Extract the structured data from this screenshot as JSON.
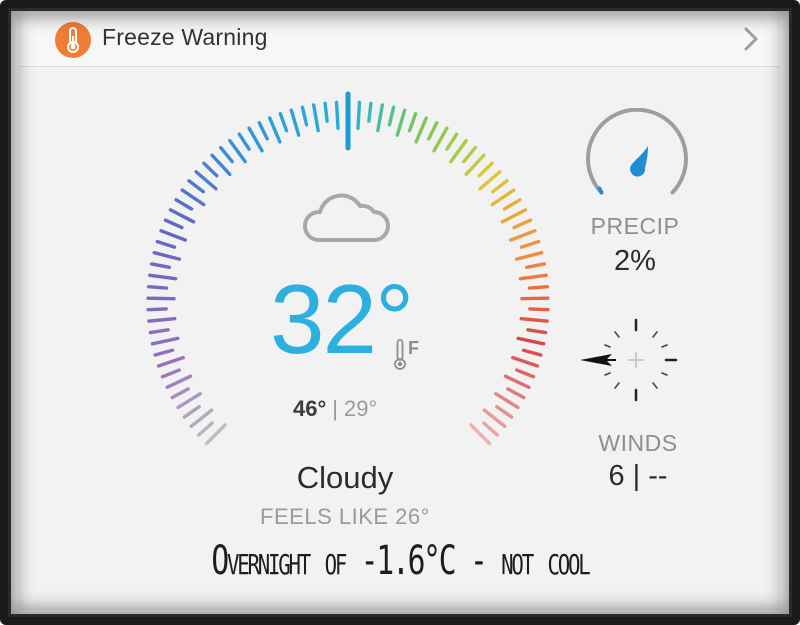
{
  "alert": {
    "title": "Freeze Warning",
    "icon": "thermometer-icon",
    "icon_color": "#f07d35"
  },
  "weather": {
    "temperature": "32°",
    "unit": "F",
    "high": "46°",
    "separator": "|",
    "low": "29°",
    "condition": "Cloudy",
    "condition_icon": "cloud-icon",
    "feels_like": "FEELS LIKE 26°",
    "accent_color": "#2bb0df"
  },
  "precip": {
    "label": "PRECIP",
    "value": "2%",
    "icon": "raindrop-icon",
    "level": 0.02
  },
  "winds": {
    "label": "WINDS",
    "value": "6 | --",
    "icon": "compass-icon"
  },
  "caption": "Overnight of -1.6°C - not cool"
}
